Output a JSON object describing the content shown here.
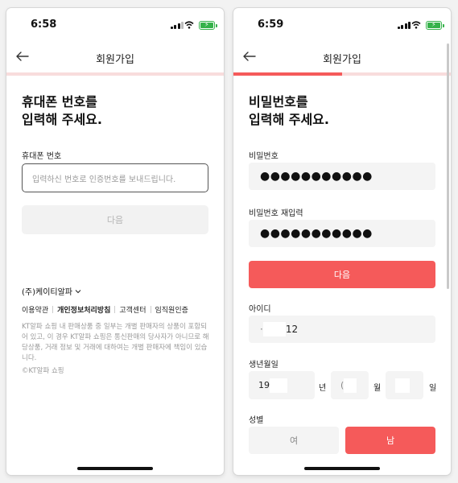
{
  "left": {
    "time": "6:58",
    "title": "회원가입",
    "heading_line1": "휴대폰 번호를",
    "heading_line2": "입력해 주세요.",
    "phone_label": "휴대폰 번호",
    "phone_placeholder": "입력하신 번호로 인증번호를 보내드립니다.",
    "next_label": "다음",
    "company": "(주)케이티알파",
    "links": [
      "이용약관",
      "개인정보처리방침",
      "고객센터",
      "임직원인증"
    ],
    "notice": "KT알파 쇼핑 내 판매상품 중 일부는 개별 판매자의 상품이 포함되어 있고, 이 경우 KT알파 쇼핑은 통신판매의 당사자가 아니므로 해당상품, 거래 정보 및 거래에 대하여는 개별 판매자에 책임이 있습니다.",
    "copyright": "©KT알파 쇼핑"
  },
  "right": {
    "time": "6:59",
    "title": "회원가입",
    "progress": 0.5,
    "heading_line1": "비밀번호를",
    "heading_line2": "입력해 주세요.",
    "password_label": "비밀번호",
    "password_value": "●●●●●●●●●●●",
    "password_confirm_label": "비밀번호 재입력",
    "password_confirm_value": "●●●●●●●●●●●",
    "next_label": "다음",
    "id_label": "아이디",
    "id_prefix": "·",
    "id_suffix": "12",
    "birth_label": "생년월일",
    "birth_year_prefix": "19",
    "birth_year_unit": "년",
    "birth_month_prefix": "(",
    "birth_month_unit": "월",
    "birth_day_unit": "일",
    "gender_label": "성별",
    "gender_female": "여",
    "gender_male": "남"
  },
  "colors": {
    "accent": "#f55a5a",
    "progress_track": "#f8dcdc",
    "battery": "#35b24a"
  },
  "icons": {
    "back": "arrow-left-icon",
    "signal": "signal-icon",
    "wifi": "wifi-icon",
    "battery": "battery-charging-icon",
    "chevron": "chevron-down-icon"
  }
}
